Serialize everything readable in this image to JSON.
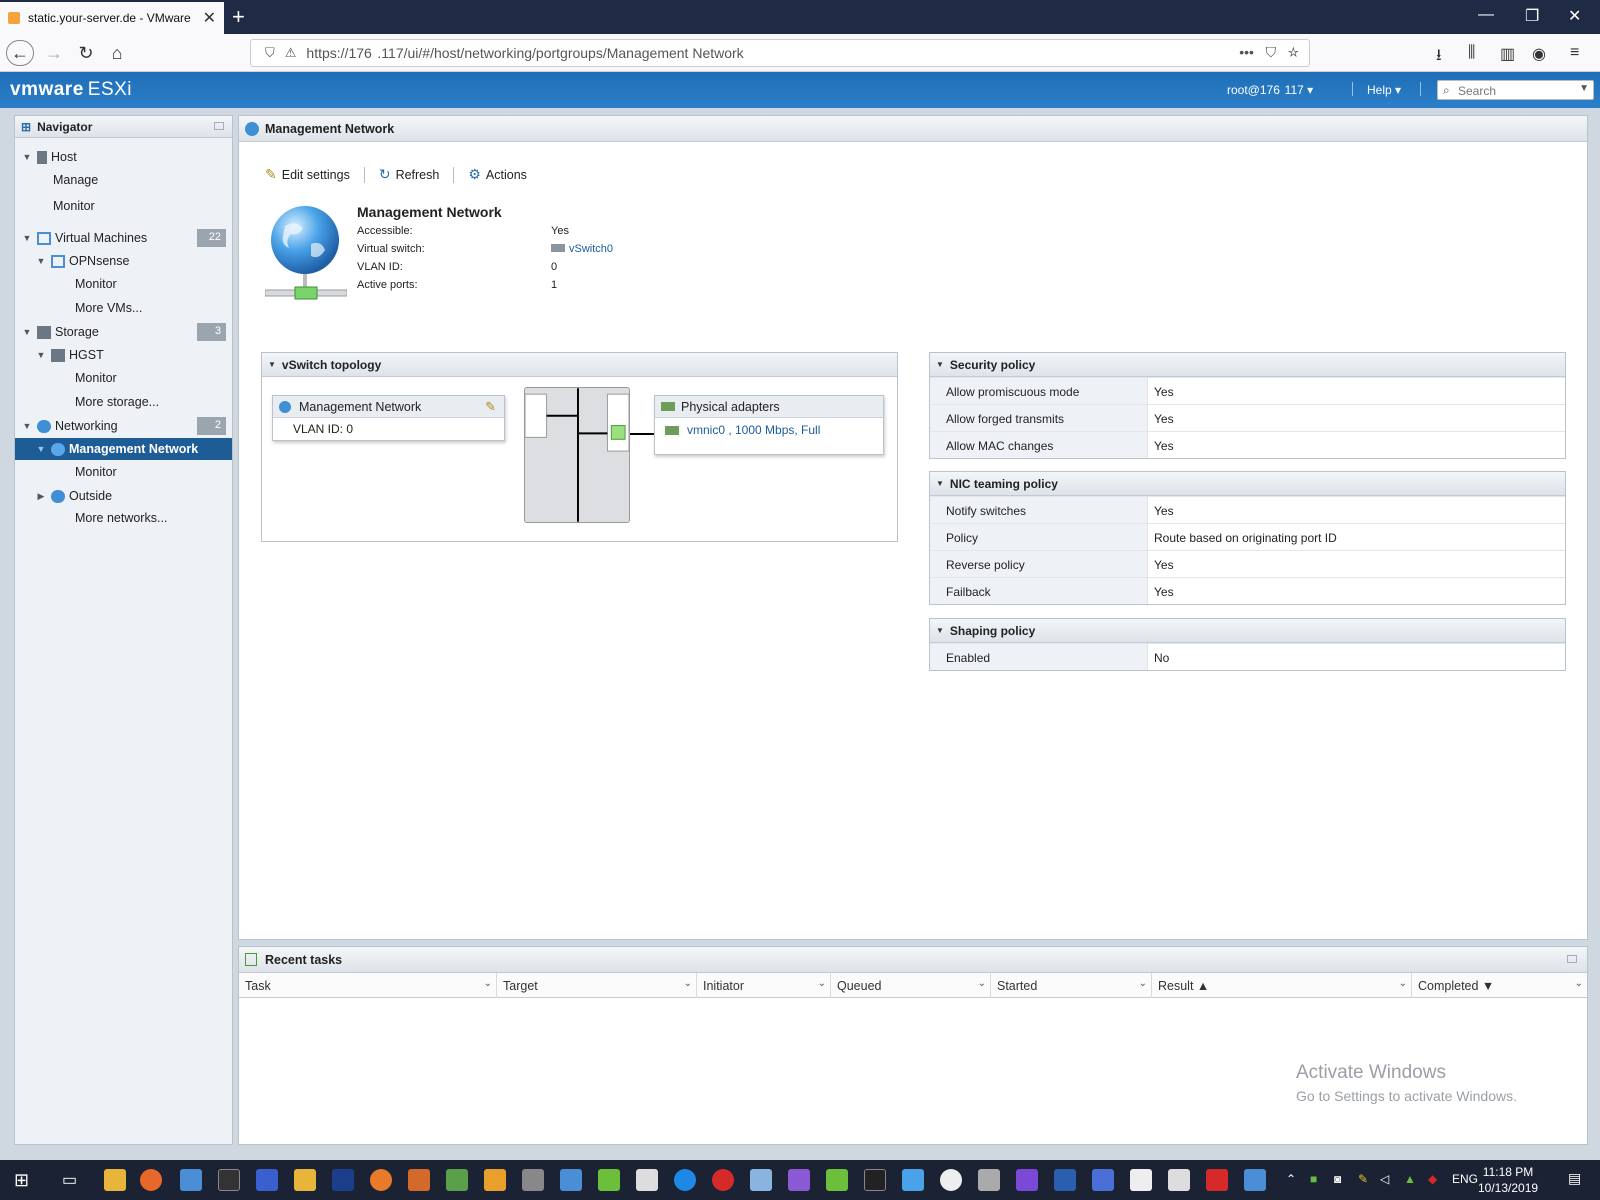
{
  "browser": {
    "tab_title": "static.your-server.de - VMware",
    "url": "https://176  .117/ui/#/host/networking/portgroups/Management Network"
  },
  "esxi": {
    "logo_vm": "vmware",
    "logo_product": "ESXi",
    "user": "root@176  117",
    "help": "Help",
    "search_placeholder": "Search"
  },
  "navigator": {
    "title": "Navigator",
    "host": "Host",
    "manage": "Manage",
    "monitor": "Monitor",
    "vms": "Virtual Machines",
    "vms_count": "22",
    "opnsense": "OPNsense",
    "more_vms": "More VMs...",
    "storage": "Storage",
    "storage_count": "3",
    "hgst": "HGST",
    "more_storage": "More storage...",
    "networking": "Networking",
    "networking_count": "2",
    "mgmt_network": "Management Network",
    "outside": "Outside",
    "more_networks": "More networks..."
  },
  "main": {
    "title": "Management Network",
    "toolbar": {
      "edit": "Edit settings",
      "refresh": "Refresh",
      "actions": "Actions"
    },
    "summary": {
      "name": "Management Network",
      "props": [
        {
          "label": "Accessible:",
          "value": "Yes"
        },
        {
          "label": "Virtual switch:",
          "value": "vSwitch0"
        },
        {
          "label": "VLAN ID:",
          "value": "0"
        },
        {
          "label": "Active ports:",
          "value": "1"
        }
      ]
    },
    "topology": {
      "title": "vSwitch topology",
      "portgroup": "Management Network",
      "vlan": "VLAN ID: 0",
      "physical_adapters": "Physical adapters",
      "nic": "vmnic0 , 1000 Mbps, Full"
    },
    "security": {
      "title": "Security policy",
      "rows": [
        {
          "k": "Allow promiscuous mode",
          "v": "Yes"
        },
        {
          "k": "Allow forged transmits",
          "v": "Yes"
        },
        {
          "k": "Allow MAC changes",
          "v": "Yes"
        }
      ]
    },
    "teaming": {
      "title": "NIC teaming policy",
      "rows": [
        {
          "k": "Notify switches",
          "v": "Yes"
        },
        {
          "k": "Policy",
          "v": "Route based on originating port ID"
        },
        {
          "k": "Reverse policy",
          "v": "Yes"
        },
        {
          "k": "Failback",
          "v": "Yes"
        }
      ]
    },
    "shaping": {
      "title": "Shaping policy",
      "rows": [
        {
          "k": "Enabled",
          "v": "No"
        }
      ]
    }
  },
  "tasks": {
    "title": "Recent tasks",
    "columns": [
      "Task",
      "Target",
      "Initiator",
      "Queued",
      "Started",
      "Result ▲",
      "Completed ▼"
    ]
  },
  "watermark": {
    "line1": "Activate Windows",
    "line2": "Go to Settings to activate Windows."
  },
  "taskbar": {
    "lang": "ENG",
    "time": "11:18 PM",
    "date": "10/13/2019"
  }
}
